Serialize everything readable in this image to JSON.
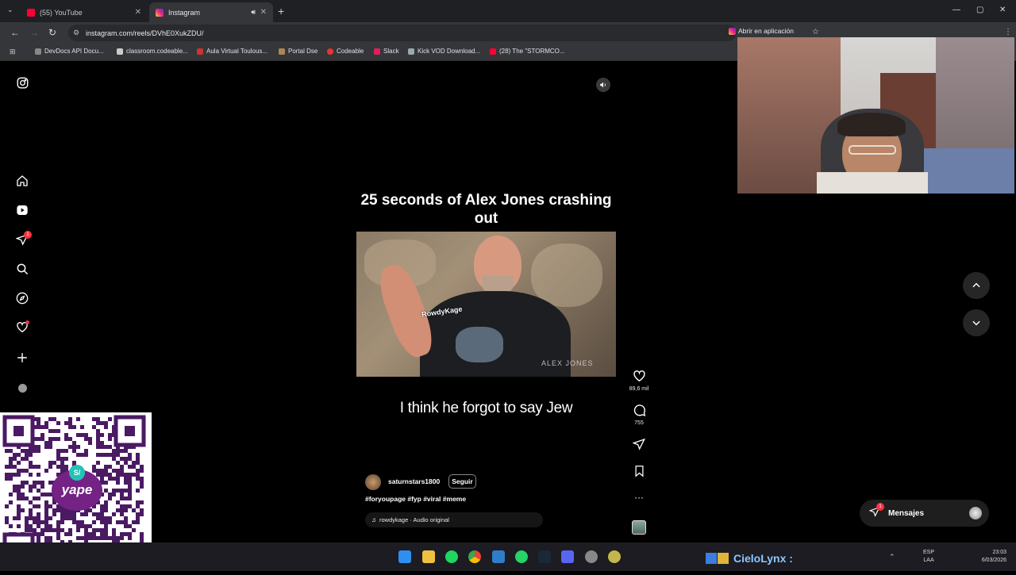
{
  "browser": {
    "tabs": [
      {
        "label": "(55) YouTube"
      },
      {
        "label": "Instagram"
      }
    ],
    "url": "instagram.com/reels/DVhE0XukZDU/",
    "open_app_label": "Abrir en aplicación",
    "bookmarks": [
      {
        "label": "DevDocs API Docu..."
      },
      {
        "label": "classroom.codeable..."
      },
      {
        "label": "Aula Virtual Toulous..."
      },
      {
        "label": "Portal Dse"
      },
      {
        "label": "Codeable"
      },
      {
        "label": "Slack"
      },
      {
        "label": "Kick VOD Download..."
      },
      {
        "label": "(28) The \"STORMCO..."
      }
    ]
  },
  "instagram": {
    "notification_badge": "1",
    "reel": {
      "title": "25 seconds of Alex Jones crashing out",
      "caption_overlay": "I think he forgot to say Jew",
      "watermark": "RowdyKage",
      "brand_text": "ALEX JONES",
      "username": "saturnstars1800",
      "follow_label": "Seguir",
      "hashtags": "#foryoupage #fyp #viral #meme",
      "audio": "rowdykage · Audio original"
    },
    "actions": {
      "likes": "89,6 mil",
      "comments": "755"
    },
    "messages": {
      "label": "Mensajes",
      "badge": "1"
    }
  },
  "overlay": {
    "streamer_name": "CieloLynx :",
    "qr_brand": "yape"
  },
  "taskbar": {
    "lang_top": "ESP",
    "lang_bottom": "LAA",
    "time": "23:03",
    "date": "6/03/2026"
  },
  "colors": {
    "instagram_bg": "#000000",
    "badge_red": "#ff3040",
    "yape_purple": "#742284"
  }
}
